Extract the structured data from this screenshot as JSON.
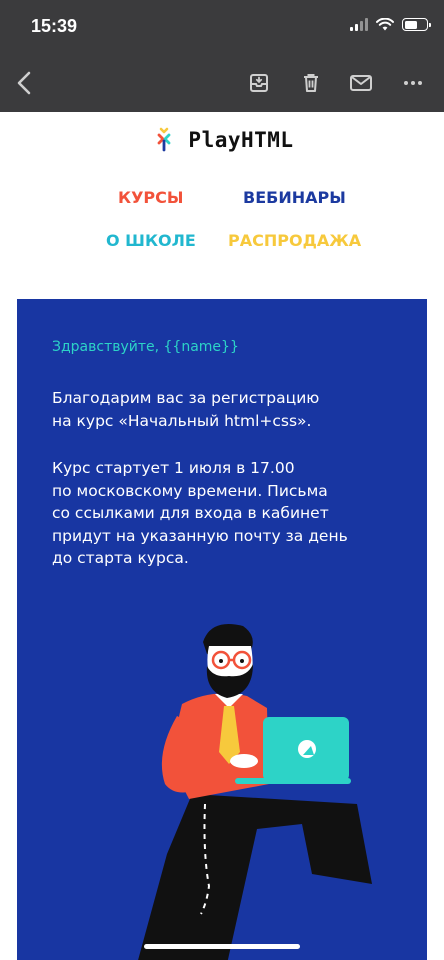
{
  "status_bar": {
    "time": "15:39",
    "icons": [
      "cellular-signal-icon",
      "wifi-icon",
      "battery-icon"
    ],
    "battery_level": 0.6
  },
  "toolbar": {
    "icons": [
      "back-arrow-icon",
      "archive-icon",
      "trash-icon",
      "mail-icon",
      "more-icon"
    ]
  },
  "email": {
    "brand": {
      "name": "PlayHTML",
      "logo_icon": "playhtml-logo-icon"
    },
    "nav": [
      {
        "label": "КУРСЫ",
        "color": "#f2523a"
      },
      {
        "label": "ВЕБИНАРЫ",
        "color": "#1c3aa0"
      },
      {
        "label": "О ШКОЛЕ",
        "color": "#21b7cf"
      },
      {
        "label": "РАСПРОДАЖА",
        "color": "#f7c93c"
      }
    ],
    "card": {
      "background": "#1836a2",
      "greeting": "Здравствуйте, {{name}}",
      "paragraph_1": "Благодарим вас за регистрацию\nна курс «Начальный html+css».",
      "paragraph_2": "Курс стартует 1 июля в 17.00\nпо московскому времени. Письма\nсо ссылками для входа в кабинет\nпридут на указанную почту за день\nдо старта курса.",
      "illustration": "man-with-laptop-illustration"
    }
  },
  "colors": {
    "toolbar_bg": "#3b3b3d",
    "accent_teal": "#2dd3c7",
    "shirt_red": "#f2523a"
  }
}
